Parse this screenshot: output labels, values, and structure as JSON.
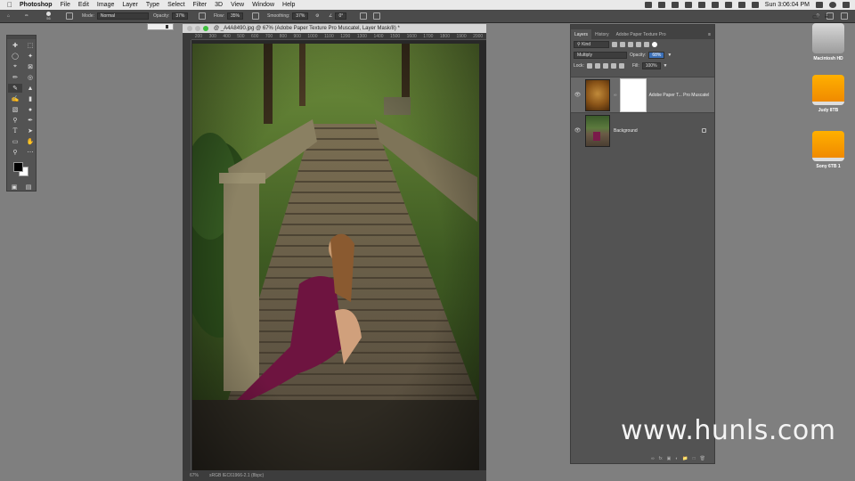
{
  "menubar": {
    "app_name": "Photoshop",
    "items": [
      "File",
      "Edit",
      "Image",
      "Layer",
      "Type",
      "Select",
      "Filter",
      "3D",
      "View",
      "Window",
      "Help"
    ],
    "clock": "Sun 3:06:04 PM"
  },
  "options_bar": {
    "brush_size": "56",
    "mode_label": "Mode:",
    "mode_value": "Normal",
    "opacity_label": "Opacity:",
    "opacity_value": "37%",
    "flow_label": "Flow:",
    "flow_value": "35%",
    "smoothing_label": "Smoothing:",
    "smoothing_value": "37%",
    "angle_value": "0°"
  },
  "document": {
    "tab_title": "@ _A4A8490.jpg @ 67% (Adobe Paper Texture Pro Muscatel, Layer Mask/8) *",
    "ruler_ticks": [
      "200",
      "300",
      "400",
      "500",
      "600",
      "700",
      "800",
      "900",
      "1000",
      "1100",
      "1200",
      "1300",
      "1400",
      "1500",
      "1600",
      "1700",
      "1800",
      "1900",
      "2000"
    ],
    "zoom": "67%",
    "profile": "sRGB IEC61966-2.1 (8bpc)"
  },
  "layers_panel": {
    "tabs": [
      "Layers",
      "History",
      "Adobe Paper Texture Pro"
    ],
    "kind_label": "Kind",
    "blend_mode": "Multiply",
    "opacity_label": "Opacity:",
    "opacity_value": "68%",
    "lock_label": "Lock:",
    "fill_label": "Fill:",
    "fill_value": "100%",
    "layers": [
      {
        "name": "Adobe Paper T... Pro Muscatel",
        "selected": true
      },
      {
        "name": "Background",
        "selected": false
      }
    ],
    "footer_icons": [
      "link-icon",
      "fx-icon",
      "mask-icon",
      "adjustment-icon",
      "group-icon",
      "new-layer-icon",
      "trash-icon"
    ]
  },
  "desktop": {
    "drives": [
      "Macintosh HD",
      "Judy 8TB",
      "Sony 6TB 1"
    ]
  },
  "watermark": "www.hunls.com"
}
